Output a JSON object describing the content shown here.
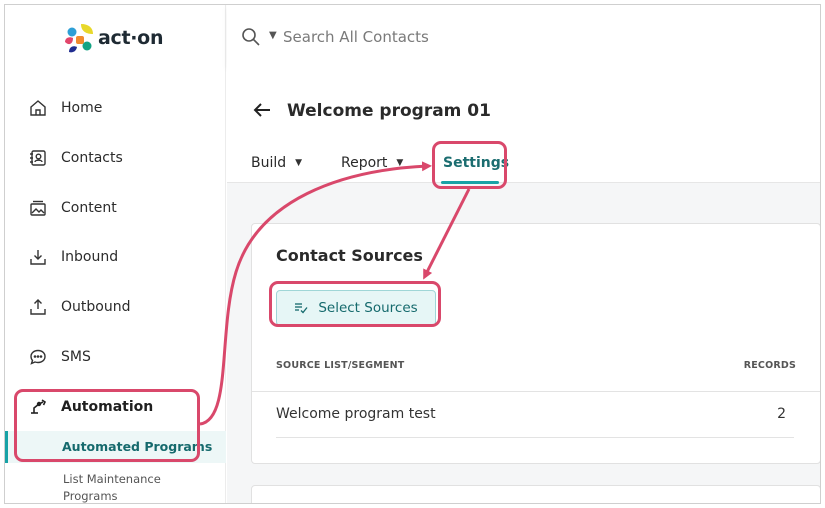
{
  "app": {
    "logo_text": "act·on"
  },
  "search": {
    "placeholder": "Search All Contacts"
  },
  "sidebar": {
    "items": [
      {
        "label": "Home",
        "icon": "home-icon"
      },
      {
        "label": "Contacts",
        "icon": "contacts-icon"
      },
      {
        "label": "Content",
        "icon": "content-icon"
      },
      {
        "label": "Inbound",
        "icon": "inbound-icon"
      },
      {
        "label": "Outbound",
        "icon": "outbound-icon"
      },
      {
        "label": "SMS",
        "icon": "sms-icon"
      },
      {
        "label": "Automation",
        "icon": "automation-icon"
      }
    ],
    "sub_items": [
      {
        "label": "Automated Programs",
        "active": true
      },
      {
        "label": "List Maintenance Programs",
        "active": false
      }
    ]
  },
  "page": {
    "title": "Welcome program 01",
    "tabs": [
      {
        "label": "Build"
      },
      {
        "label": "Report"
      },
      {
        "label": "Settings",
        "active": true
      }
    ]
  },
  "contact_sources": {
    "title": "Contact Sources",
    "button_label": "Select Sources",
    "columns": [
      "SOURCE LIST/SEGMENT",
      "RECORDS"
    ],
    "rows": [
      {
        "name": "Welcome program test",
        "records": "2"
      }
    ]
  },
  "colors": {
    "accent": "#17a2a6",
    "annotation": "#d9486b",
    "active_text": "#1b6d70"
  }
}
